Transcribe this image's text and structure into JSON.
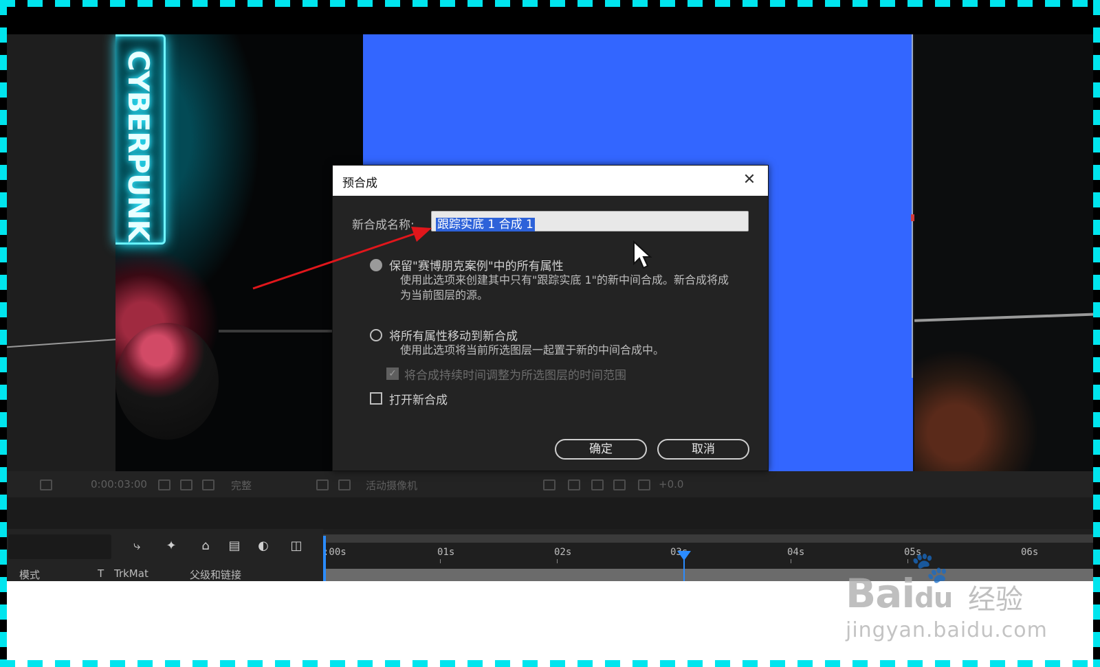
{
  "viewer": {
    "sign_text": "CYBERPUNK"
  },
  "comp_toolbar": {
    "timecode": "0:00:03:00",
    "resolution": "完整",
    "camera": "活动摄像机",
    "exposure": "+0.0"
  },
  "timeline": {
    "ticks": [
      ":00s",
      "01s",
      "02s",
      "03s",
      "04s",
      "05s",
      "06s"
    ],
    "col_mode": "模式",
    "col_t": "T",
    "col_trkmat": "TrkMat",
    "col_parent": "父级和链接"
  },
  "dialog": {
    "title": "预合成",
    "name_label": "新合成名称:",
    "name_value": "跟踪实底 1 合成 1",
    "option1_title": "保留\"赛博朋克案例\"中的所有属性",
    "option1_desc": "使用此选项来创建其中只有\"跟踪实底 1\"的新中间合成。新合成将成为当前图层的源。",
    "option2_title": "将所有属性移动到新合成",
    "option2_desc": "使用此选项将当前所选图层一起置于新的中间合成中。",
    "adjust_label": "将合成持续时间调整为所选图层的时间范围",
    "open_label": "打开新合成",
    "ok_label": "确定",
    "cancel_label": "取消"
  },
  "watermark": {
    "brand": "Bai",
    "brand_cn": "经验",
    "url": "jingyan.baidu.com"
  },
  "colors": {
    "accent": "#3366ff",
    "frame": "#00e5ee",
    "arrow": "#e0161b",
    "playhead": "#2b8cff"
  }
}
